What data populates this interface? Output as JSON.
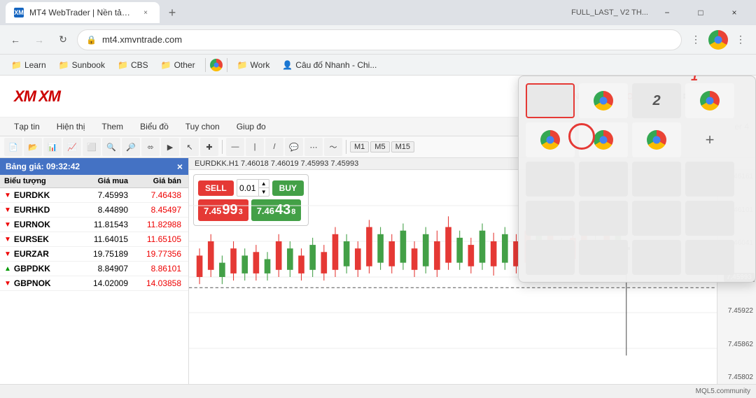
{
  "browser": {
    "title_bar": {
      "tab_title": "MT4 WebTrader | Nền tảng MT...",
      "favicon_alt": "xm-favicon",
      "new_tab_label": "+",
      "minimize_label": "−",
      "maximize_label": "□",
      "close_label": "×",
      "extra_text": "FULL_LAST_ V2 TH..."
    },
    "address_bar": {
      "url": "mt4.xmvntrade.com",
      "lock_icon": "🔒"
    },
    "bookmarks": [
      {
        "label": "Learn",
        "icon": "folder"
      },
      {
        "label": "Sunbook",
        "icon": "folder"
      },
      {
        "label": "CBS",
        "icon": "folder"
      },
      {
        "label": "Other",
        "icon": "folder"
      },
      {
        "label": "Work",
        "icon": "folder"
      },
      {
        "label": "Câu đố Nhanh - Chi...",
        "icon": "person"
      }
    ],
    "chrome_icon_label": "chrome"
  },
  "annotation": {
    "number_1": "1",
    "number_2": "2"
  },
  "tab_grid": {
    "rows": [
      [
        {
          "type": "selected",
          "has_chrome": true
        },
        {
          "type": "empty",
          "has_chrome": false
        },
        {
          "type": "empty",
          "has_chrome": false
        },
        {
          "type": "chrome",
          "has_chrome": true
        }
      ],
      [
        {
          "type": "chrome_top",
          "has_chrome": true
        },
        {
          "type": "chrome_mid",
          "has_chrome": true
        },
        {
          "type": "chrome_mid2",
          "has_chrome": true
        },
        {
          "type": "grid_plus",
          "has_chrome": false
        }
      ],
      [
        {
          "type": "empty",
          "has_chrome": false
        },
        {
          "type": "empty",
          "has_chrome": false
        },
        {
          "type": "empty",
          "has_chrome": false
        },
        {
          "type": "empty",
          "has_chrome": false
        }
      ],
      [
        {
          "type": "empty",
          "has_chrome": false
        },
        {
          "type": "empty",
          "has_chrome": false
        },
        {
          "type": "empty",
          "has_chrome": false
        },
        {
          "type": "empty",
          "has_chrome": false
        }
      ],
      [
        {
          "type": "empty",
          "has_chrome": false
        },
        {
          "type": "empty",
          "has_chrome": false
        },
        {
          "type": "empty",
          "has_chrome": false
        },
        {
          "type": "empty",
          "has_chrome": false
        }
      ]
    ]
  },
  "xm": {
    "logo": "XM",
    "nav": {
      "account_label": "QUẢN LÝ TÀI KHOẢN",
      "contact_label": "LIÊN HỆ"
    },
    "metatrader_label": "MetaTrader 4",
    "menu_items": [
      "Tạp tin",
      "Hiện thị",
      "Them",
      "Biểu đồ",
      "Tuy chon",
      "Giup đo"
    ],
    "timeframes": [
      "M1",
      "M5",
      "M15"
    ]
  },
  "market_watch": {
    "title": "Bảng giá: 09:32:42",
    "columns": [
      "Biểu tượng",
      "Giá mua",
      "Giá bán"
    ],
    "rows": [
      {
        "symbol": "EURDKK",
        "buy": "7.45993",
        "sell": "7.46438",
        "dir": "down"
      },
      {
        "symbol": "EURHKD",
        "buy": "8.44890",
        "sell": "8.45497",
        "dir": "down"
      },
      {
        "symbol": "EURNOK",
        "buy": "11.81543",
        "sell": "11.82988",
        "dir": "down"
      },
      {
        "symbol": "EURSEK",
        "buy": "11.64015",
        "sell": "11.65105",
        "dir": "down"
      },
      {
        "symbol": "EURZAR",
        "buy": "19.75189",
        "sell": "19.77356",
        "dir": "down"
      },
      {
        "symbol": "GBPDKK",
        "buy": "8.84907",
        "sell": "8.86101",
        "dir": "up"
      },
      {
        "symbol": "GBPNOK",
        "buy": "14.02009",
        "sell": "14.03858",
        "dir": "down"
      }
    ]
  },
  "chart": {
    "header": "EURDKK.H1  7.46018  7.46019  7.45993  7.45993",
    "sell_btn": "SELL",
    "buy_btn": "BUY",
    "lot_value": "0.01",
    "sell_price": {
      "main": "7.45",
      "big": "99",
      "sup": "3"
    },
    "buy_price": {
      "main": "7.46",
      "big": "43",
      "sup": "8"
    },
    "price_levels": [
      "7.46161",
      "7.46101",
      "7.46041",
      "7.45993",
      "7.45922",
      "7.45862",
      "7.45802"
    ]
  },
  "mql_bar": {
    "text": "MQL5.community"
  }
}
